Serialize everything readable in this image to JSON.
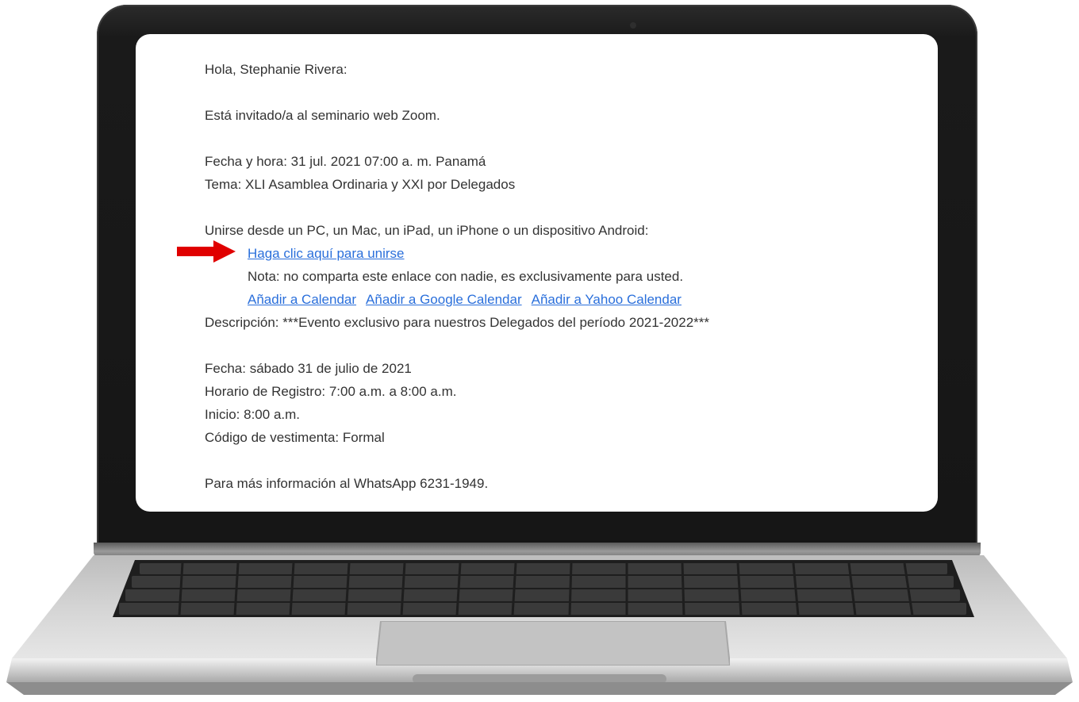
{
  "email": {
    "greeting": "Hola, Stephanie Rivera:",
    "invitation": "Está invitado/a al seminario web Zoom.",
    "date_time": "Fecha y hora: 31 jul. 2021 07:00 a. m. Panamá",
    "topic": "Tema: XLI Asamblea Ordinaria y XXI por Delegados",
    "join_instructions": "Unirse desde un PC, un Mac, un iPad, un iPhone o un dispositivo Android:",
    "join_link": "Haga clic aquí para unirse",
    "note": "Nota: no comparta este enlace con nadie, es exclusivamente para usted.",
    "calendar_links": {
      "calendar": "Añadir a Calendar",
      "google": "Añadir a Google Calendar",
      "yahoo": "Añadir a Yahoo Calendar"
    },
    "description": "Descripción: ***Evento exclusivo para nuestros Delegados del período 2021-2022***",
    "event_date": "Fecha: sábado 31 de julio de 2021",
    "registration_time": "Horario de Registro: 7:00 a.m. a 8:00 a.m.",
    "start_time": "Inicio: 8:00 a.m.",
    "dress_code": "Código de vestimenta: Formal",
    "more_info": "Para más información al WhatsApp 6231-1949."
  },
  "colors": {
    "link": "#2a6fdb",
    "arrow": "#e00000",
    "text": "#333333",
    "bezel": "#161616",
    "chassis": "#cfcfcf"
  },
  "icons": {
    "pointer": "red-arrow-right-icon"
  }
}
